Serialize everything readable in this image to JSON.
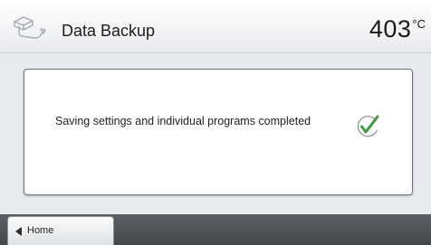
{
  "header": {
    "title": "Data Backup",
    "icon": "usb-stick-icon",
    "temperature": {
      "value": "403",
      "unit": "°C"
    }
  },
  "dialog": {
    "message": "Saving settings and individual programs completed",
    "status_icon": "checkmark-icon",
    "status_color": "#3c9a3c"
  },
  "footer": {
    "home_label": "Home",
    "home_icon": "arrow-left-icon"
  }
}
